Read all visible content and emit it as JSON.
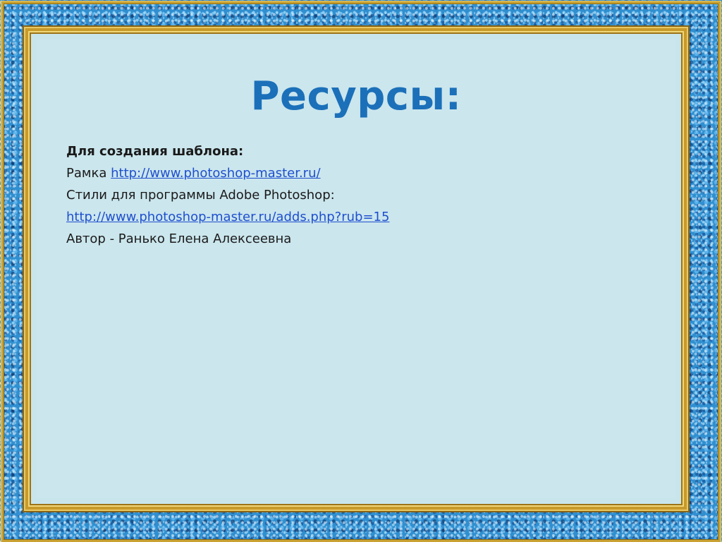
{
  "slide": {
    "title": "Ресурсы:",
    "heading": "Для создания шаблона:",
    "frame_label": "Рамка",
    "frame_link": "http://www.photoshop-master.ru/",
    "styles_text": "Стили для программы Adobe Photoshop:",
    "styles_link": "http://www.photoshop-master.ru/adds.php?rub=15",
    "author": "Автор - Ранько Елена Алексеевна"
  },
  "colors": {
    "title": "#1b70b9",
    "link": "#1f4fcf",
    "panel_background": "#cbe6ed",
    "frame_gold": "#c89a2a",
    "frame_blue": "#2f8fd0"
  }
}
